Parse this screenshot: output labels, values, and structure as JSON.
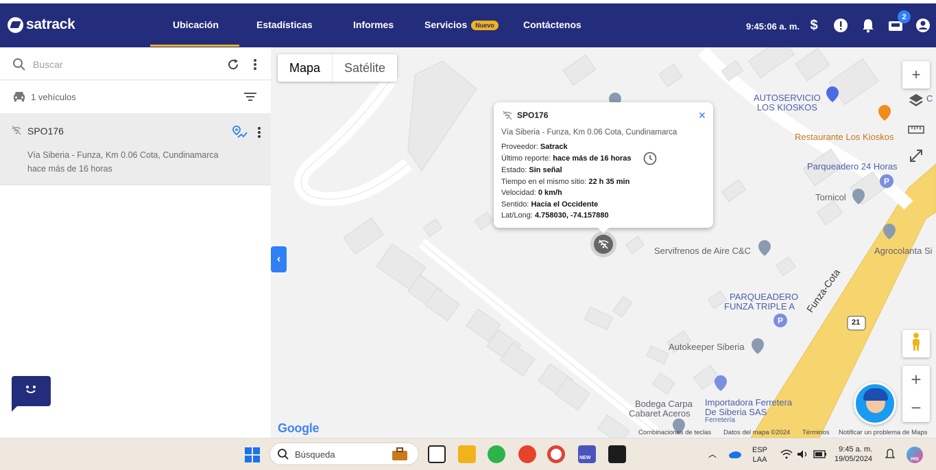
{
  "header": {
    "brand": "satrack",
    "nav": [
      {
        "label": "Ubicación",
        "active": true
      },
      {
        "label": "Estadísticas",
        "active": false
      },
      {
        "label": "Informes",
        "active": false
      },
      {
        "label": "Servicios",
        "active": false,
        "badge": "Nuevo"
      },
      {
        "label": "Contáctenos",
        "active": false
      }
    ],
    "time": "9:45:06 a. m.",
    "notification_count": "2",
    "icons": [
      "dollar-icon",
      "alert-icon",
      "bell-icon",
      "inbox-icon",
      "user-icon"
    ]
  },
  "sidebar": {
    "search_placeholder": "Buscar",
    "vehicle_count_label": "1 vehículos",
    "vehicles": [
      {
        "plate": "SPO176",
        "address": "Vía Siberia - Funza, Km 0.06 Cota, Cundinamarca",
        "last_report": "hace más de 16 horas"
      }
    ]
  },
  "map": {
    "types": [
      "Mapa",
      "Satélite"
    ],
    "selected_type": "Mapa",
    "places": {
      "autoservicio": "AUTOSERVICIO\nLOS KIOSKOS",
      "restaurante": "Restaurante Los Kioskos",
      "parqueadero24": "Parqueadero 24 Horas",
      "tornicol": "Tornicol",
      "agrocolanta": "Agrocolanta Si",
      "servifrenos": "Servifrenos de Aire C&C",
      "parqueadero_funza_1": "PARQUEADERO",
      "parqueadero_funza_2": "FUNZA TRIPLE A",
      "autokeeper": "Autokeeper Siberia",
      "bodega_1": "Bodega Carpa",
      "bodega_2": "Cabaret Aceros",
      "importadora_1": "Importadora Ferretera",
      "importadora_2": "De Siberia SAS",
      "importadora_3": "Ferretería",
      "road_name": "Funza-Cota",
      "road_shield": "21",
      "edge_c": "C"
    },
    "google_logo": "Google",
    "attribution": {
      "shortcuts": "Combinaciones de teclas",
      "data": "Datos del mapa ©2024",
      "terms": "Términos",
      "report": "Notificar un problema de Maps"
    },
    "info_window": {
      "plate": "SPO176",
      "address": "Vía Siberia - Funza, Km 0.06 Cota, Cundinamarca",
      "provider_label": "Proveedor:",
      "provider": "Satrack",
      "last_report_label": "Último reporte:",
      "last_report": "hace más de 16 horas",
      "status_label": "Estado:",
      "status": "Sin señal",
      "same_site_label": "Tiempo en el mismo sitio:",
      "same_site": "22 h 35 min",
      "speed_label": "Velocidad:",
      "speed": "0 km/h",
      "direction_label": "Sentido:",
      "direction": "Hacia el Occidente",
      "latlong_label": "Lat/Long:",
      "latlong": "4.758030, -74.157880"
    }
  },
  "taskbar": {
    "search_placeholder": "Búsqueda",
    "lang_1": "ESP",
    "lang_2": "LAA",
    "time": "9:45 a. m.",
    "date": "19/05/2024",
    "new_badge": "NEW",
    "pre_badge": "PRE"
  },
  "colors": {
    "header_bg": "#242c7c",
    "accent": "#f0b31a",
    "primary_blue": "#2f7ff5",
    "road_yellow": "#f7d56e"
  }
}
